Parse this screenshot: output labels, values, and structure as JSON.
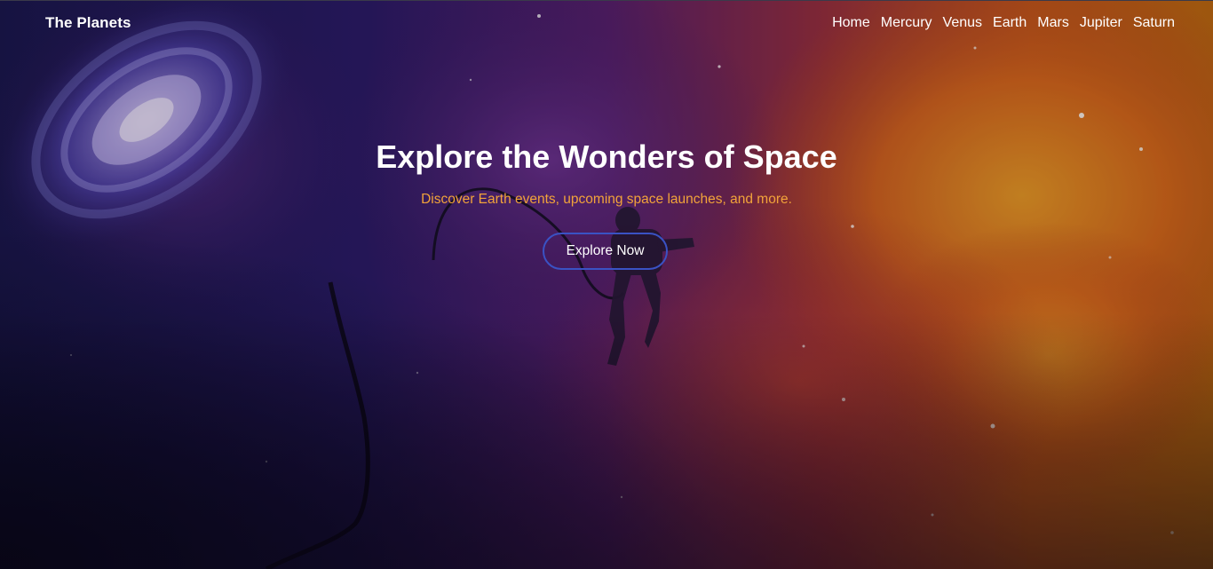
{
  "navbar": {
    "brand": "The Planets",
    "links": [
      "Home",
      "Mercury",
      "Venus",
      "Earth",
      "Mars",
      "Jupiter",
      "Saturn"
    ]
  },
  "hero": {
    "title": "Explore the Wonders of Space",
    "subtitle": "Discover Earth events, upcoming space launches, and more.",
    "cta_label": "Explore Now"
  },
  "colors": {
    "subtitle": "#f2a33a",
    "button_border": "#3a52c4",
    "text": "#ffffff"
  },
  "background": {
    "description_icon": "space-nebula-astronaut-image"
  }
}
